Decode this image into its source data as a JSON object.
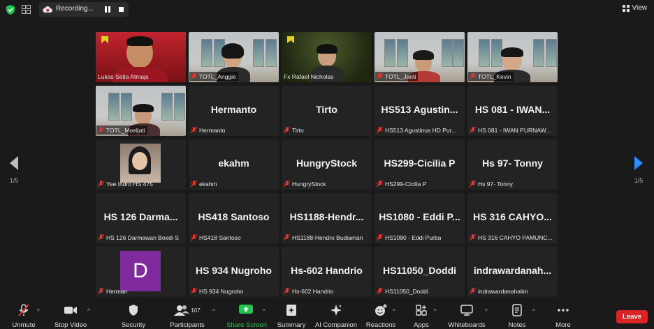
{
  "topbar": {
    "recording_label": "Recording...",
    "view_label": "View"
  },
  "pager": {
    "left": "1/5",
    "right": "1/5"
  },
  "tiles": [
    {
      "name": "Lukas Setia Atmaja"
    },
    {
      "name": "TOTL_Anggie"
    },
    {
      "name": "Fx Rafael Nicholas"
    },
    {
      "name": "TOTL_Janti"
    },
    {
      "name": "TOTL_Kevin"
    },
    {
      "name": "TOTL_Moeljati"
    },
    {
      "big": "Hermanto",
      "name": "Hermanto"
    },
    {
      "big": "Tirto",
      "name": "Tirto"
    },
    {
      "big": "HS513 Agustin...",
      "name": "HS513 Agustinus HD Pur..."
    },
    {
      "big": "HS 081 - IWAN...",
      "name": "HS 081 - IWAN PURNAW..."
    },
    {
      "name": "Yee Indro HS 475"
    },
    {
      "big": "ekahm",
      "name": "ekahm"
    },
    {
      "big": "HungryStock",
      "name": "HungryStock"
    },
    {
      "big": "HS299-Cicilia P",
      "name": "HS299-Cicilia P"
    },
    {
      "big": "Hs 97- Tonny",
      "name": "Hs 97- Tonny"
    },
    {
      "big": "HS 126 Darma...",
      "name": "HS 126 Darmawan Boedi S"
    },
    {
      "big": "HS418 Santoso",
      "name": "HS418 Santoso"
    },
    {
      "big": "HS1188-Hendr...",
      "name": "HS1188-Hendro Budiaman"
    },
    {
      "big": "HS1080 - Eddi P...",
      "name": "HS1080 - Eddi Purba"
    },
    {
      "big": "HS 316 CAHYO...",
      "name": "HS 316 CAHYO PAMUNC..."
    },
    {
      "avatar": "D",
      "name": "Herman"
    },
    {
      "big": "HS 934 Nugroho",
      "name": "HS 934 Nugroho"
    },
    {
      "big": "Hs-602 Handrio",
      "name": "Hs-602 Handrio"
    },
    {
      "big": "HS11050_Doddi",
      "name": "HS11050_Doddi"
    },
    {
      "big": "indrawardanah...",
      "name": "indrawardanahalim"
    }
  ],
  "toolbar": {
    "unmute": "Unmute",
    "stop_video": "Stop Video",
    "security": "Security",
    "participants": "Participants",
    "participants_count": "107",
    "share_screen": "Share Screen",
    "summary": "Summary",
    "ai_companion": "AI Companion",
    "reactions": "Reactions",
    "apps": "Apps",
    "whiteboards": "Whiteboards",
    "notes": "Notes",
    "more": "More",
    "leave": "Leave"
  },
  "colors": {
    "active_speaker": "#e7ea63",
    "share_green": "#23c552",
    "leave_red": "#d92526",
    "avatar_purple": "#7f2b9e"
  }
}
